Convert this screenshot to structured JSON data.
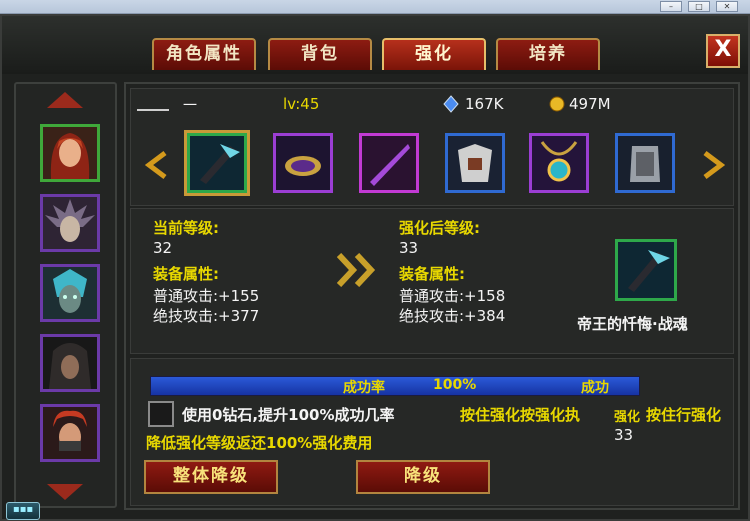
{
  "window": {
    "min": "–",
    "max": "□",
    "close": "✕"
  },
  "tabs": [
    {
      "label": "角色属性"
    },
    {
      "label": "背包"
    },
    {
      "label": "强化"
    },
    {
      "label": "培养"
    }
  ],
  "close_label": "X",
  "header": {
    "name": "一",
    "level": "lv:45",
    "diamonds": "167K",
    "gold": "497M"
  },
  "current": {
    "level_label": "当前等级:",
    "level_value": "32",
    "attr_label": "装备属性:",
    "normal_attack": "普通攻击:+155",
    "skill_attack": "绝技攻击:+377"
  },
  "after": {
    "level_label": "强化后等级:",
    "level_value": "33",
    "attr_label": "装备属性:",
    "normal_attack": "普通攻击:+158",
    "skill_attack": "绝技攻击:+384"
  },
  "item_name": "帝王的忏悔·战魂",
  "enhance": {
    "rate_label": "成功率",
    "rate_value": "100%",
    "status": "成功",
    "diamond_option": "使用0钻石,提升100%成功几率",
    "hint": "按住强化按强化执",
    "hint2": "强化",
    "hint3": "按住行强化",
    "count": "33",
    "refund_note": "降低强化等级返还100%强化费用",
    "btn_overall_down": "整体降级",
    "btn_down": "降级"
  },
  "colors": {
    "accent": "#e8d800",
    "tab_red": "#8d1c12"
  }
}
